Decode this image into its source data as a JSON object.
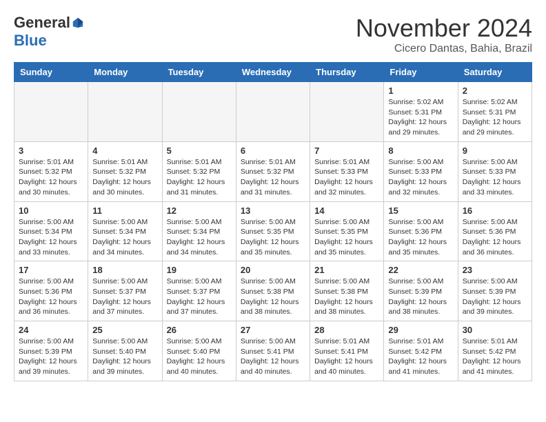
{
  "logo": {
    "general": "General",
    "blue": "Blue"
  },
  "title": "November 2024",
  "subtitle": "Cicero Dantas, Bahia, Brazil",
  "days_of_week": [
    "Sunday",
    "Monday",
    "Tuesday",
    "Wednesday",
    "Thursday",
    "Friday",
    "Saturday"
  ],
  "weeks": [
    [
      {
        "day": "",
        "info": ""
      },
      {
        "day": "",
        "info": ""
      },
      {
        "day": "",
        "info": ""
      },
      {
        "day": "",
        "info": ""
      },
      {
        "day": "",
        "info": ""
      },
      {
        "day": "1",
        "info": "Sunrise: 5:02 AM\nSunset: 5:31 PM\nDaylight: 12 hours and 29 minutes."
      },
      {
        "day": "2",
        "info": "Sunrise: 5:02 AM\nSunset: 5:31 PM\nDaylight: 12 hours and 29 minutes."
      }
    ],
    [
      {
        "day": "3",
        "info": "Sunrise: 5:01 AM\nSunset: 5:32 PM\nDaylight: 12 hours and 30 minutes."
      },
      {
        "day": "4",
        "info": "Sunrise: 5:01 AM\nSunset: 5:32 PM\nDaylight: 12 hours and 30 minutes."
      },
      {
        "day": "5",
        "info": "Sunrise: 5:01 AM\nSunset: 5:32 PM\nDaylight: 12 hours and 31 minutes."
      },
      {
        "day": "6",
        "info": "Sunrise: 5:01 AM\nSunset: 5:32 PM\nDaylight: 12 hours and 31 minutes."
      },
      {
        "day": "7",
        "info": "Sunrise: 5:01 AM\nSunset: 5:33 PM\nDaylight: 12 hours and 32 minutes."
      },
      {
        "day": "8",
        "info": "Sunrise: 5:00 AM\nSunset: 5:33 PM\nDaylight: 12 hours and 32 minutes."
      },
      {
        "day": "9",
        "info": "Sunrise: 5:00 AM\nSunset: 5:33 PM\nDaylight: 12 hours and 33 minutes."
      }
    ],
    [
      {
        "day": "10",
        "info": "Sunrise: 5:00 AM\nSunset: 5:34 PM\nDaylight: 12 hours and 33 minutes."
      },
      {
        "day": "11",
        "info": "Sunrise: 5:00 AM\nSunset: 5:34 PM\nDaylight: 12 hours and 34 minutes."
      },
      {
        "day": "12",
        "info": "Sunrise: 5:00 AM\nSunset: 5:34 PM\nDaylight: 12 hours and 34 minutes."
      },
      {
        "day": "13",
        "info": "Sunrise: 5:00 AM\nSunset: 5:35 PM\nDaylight: 12 hours and 35 minutes."
      },
      {
        "day": "14",
        "info": "Sunrise: 5:00 AM\nSunset: 5:35 PM\nDaylight: 12 hours and 35 minutes."
      },
      {
        "day": "15",
        "info": "Sunrise: 5:00 AM\nSunset: 5:36 PM\nDaylight: 12 hours and 35 minutes."
      },
      {
        "day": "16",
        "info": "Sunrise: 5:00 AM\nSunset: 5:36 PM\nDaylight: 12 hours and 36 minutes."
      }
    ],
    [
      {
        "day": "17",
        "info": "Sunrise: 5:00 AM\nSunset: 5:36 PM\nDaylight: 12 hours and 36 minutes."
      },
      {
        "day": "18",
        "info": "Sunrise: 5:00 AM\nSunset: 5:37 PM\nDaylight: 12 hours and 37 minutes."
      },
      {
        "day": "19",
        "info": "Sunrise: 5:00 AM\nSunset: 5:37 PM\nDaylight: 12 hours and 37 minutes."
      },
      {
        "day": "20",
        "info": "Sunrise: 5:00 AM\nSunset: 5:38 PM\nDaylight: 12 hours and 38 minutes."
      },
      {
        "day": "21",
        "info": "Sunrise: 5:00 AM\nSunset: 5:38 PM\nDaylight: 12 hours and 38 minutes."
      },
      {
        "day": "22",
        "info": "Sunrise: 5:00 AM\nSunset: 5:39 PM\nDaylight: 12 hours and 38 minutes."
      },
      {
        "day": "23",
        "info": "Sunrise: 5:00 AM\nSunset: 5:39 PM\nDaylight: 12 hours and 39 minutes."
      }
    ],
    [
      {
        "day": "24",
        "info": "Sunrise: 5:00 AM\nSunset: 5:39 PM\nDaylight: 12 hours and 39 minutes."
      },
      {
        "day": "25",
        "info": "Sunrise: 5:00 AM\nSunset: 5:40 PM\nDaylight: 12 hours and 39 minutes."
      },
      {
        "day": "26",
        "info": "Sunrise: 5:00 AM\nSunset: 5:40 PM\nDaylight: 12 hours and 40 minutes."
      },
      {
        "day": "27",
        "info": "Sunrise: 5:00 AM\nSunset: 5:41 PM\nDaylight: 12 hours and 40 minutes."
      },
      {
        "day": "28",
        "info": "Sunrise: 5:01 AM\nSunset: 5:41 PM\nDaylight: 12 hours and 40 minutes."
      },
      {
        "day": "29",
        "info": "Sunrise: 5:01 AM\nSunset: 5:42 PM\nDaylight: 12 hours and 41 minutes."
      },
      {
        "day": "30",
        "info": "Sunrise: 5:01 AM\nSunset: 5:42 PM\nDaylight: 12 hours and 41 minutes."
      }
    ]
  ]
}
